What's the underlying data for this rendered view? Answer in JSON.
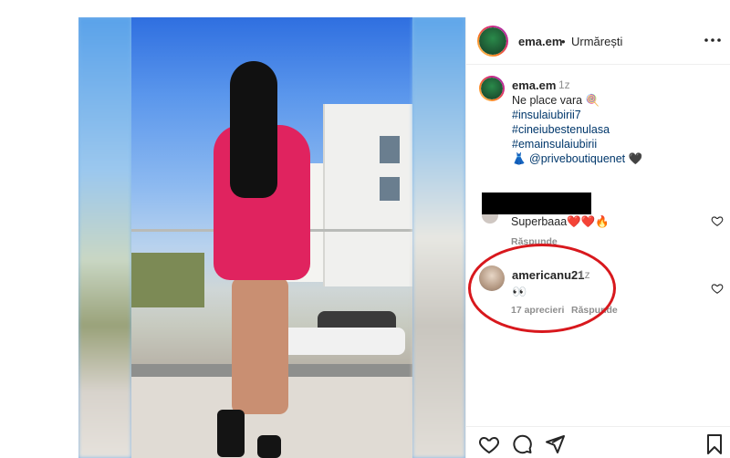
{
  "post": {
    "username": "ema.em",
    "separator": "•",
    "follow_status": "Urmărești",
    "more_icon": "more-horizontal-icon"
  },
  "caption": {
    "username": "ema.em",
    "time": "1z",
    "line1": "Ne place vara 🍭",
    "tags": [
      "#insulaiubirii7",
      "#cineiubestenulasa",
      "#emainsulaiubirii"
    ],
    "mention": "👗 @priveboutiquenet 🖤"
  },
  "comments": [
    {
      "username_redacted": true,
      "text": "Superbaaa❤️❤️🔥",
      "reply_label": "Răspunde"
    },
    {
      "username": "americanu21",
      "time": "1z",
      "text": "👀",
      "likes_label": "17 aprecieri",
      "reply_label": "Răspunde"
    }
  ],
  "actions": [
    "heart-icon",
    "comment-icon",
    "share-icon",
    "bookmark-icon"
  ],
  "colors": {
    "highlight_ellipse": "#d8181d",
    "hashtag": "#00376b",
    "muted": "#8e8e8e"
  }
}
